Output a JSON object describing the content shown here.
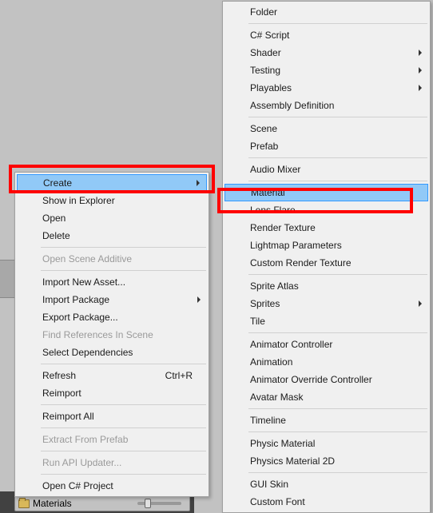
{
  "footer": {
    "label": "Materials"
  },
  "leftMenu": {
    "create": "Create",
    "showInExplorer": "Show in Explorer",
    "open": "Open",
    "delete": "Delete",
    "openSceneAdditive": "Open Scene Additive",
    "importNewAsset": "Import New Asset...",
    "importPackage": "Import Package",
    "exportPackage": "Export Package...",
    "findReferences": "Find References In Scene",
    "selectDependencies": "Select Dependencies",
    "refresh": "Refresh",
    "refreshShortcut": "Ctrl+R",
    "reimport": "Reimport",
    "reimportAll": "Reimport All",
    "extractFromPrefab": "Extract From Prefab",
    "runApiUpdater": "Run API Updater...",
    "openCsProject": "Open C# Project"
  },
  "rightMenu": {
    "folder": "Folder",
    "csScript": "C# Script",
    "shader": "Shader",
    "testing": "Testing",
    "playables": "Playables",
    "assemblyDefinition": "Assembly Definition",
    "scene": "Scene",
    "prefab": "Prefab",
    "audioMixer": "Audio Mixer",
    "material": "Material",
    "lensFlare": "Lens Flare",
    "renderTexture": "Render Texture",
    "lightmapParameters": "Lightmap Parameters",
    "customRenderTexture": "Custom Render Texture",
    "spriteAtlas": "Sprite Atlas",
    "sprites": "Sprites",
    "tile": "Tile",
    "animatorController": "Animator Controller",
    "animation": "Animation",
    "animatorOverride": "Animator Override Controller",
    "avatarMask": "Avatar Mask",
    "timeline": "Timeline",
    "physicMaterial": "Physic Material",
    "physicsMaterial2d": "Physics Material 2D",
    "guiSkin": "GUI Skin",
    "customFont": "Custom Font"
  }
}
